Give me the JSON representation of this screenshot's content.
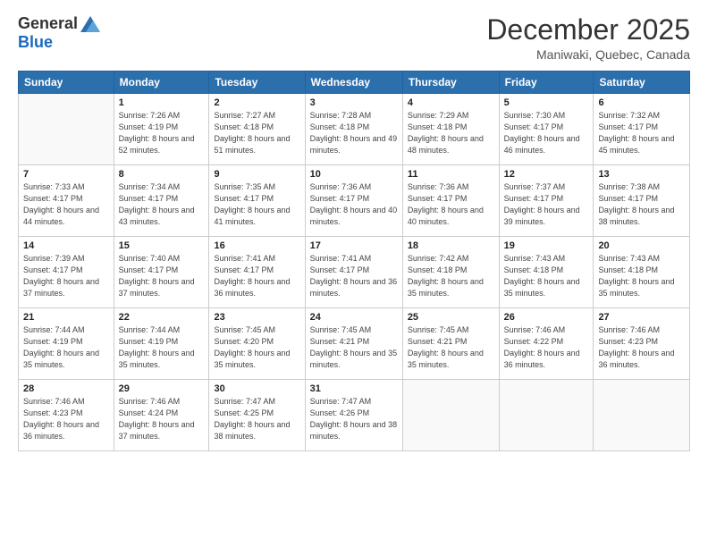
{
  "logo": {
    "general": "General",
    "blue": "Blue"
  },
  "title": "December 2025",
  "location": "Maniwaki, Quebec, Canada",
  "days_header": [
    "Sunday",
    "Monday",
    "Tuesday",
    "Wednesday",
    "Thursday",
    "Friday",
    "Saturday"
  ],
  "weeks": [
    [
      {
        "num": "",
        "sunrise": "",
        "sunset": "",
        "daylight": ""
      },
      {
        "num": "1",
        "sunrise": "Sunrise: 7:26 AM",
        "sunset": "Sunset: 4:19 PM",
        "daylight": "Daylight: 8 hours and 52 minutes."
      },
      {
        "num": "2",
        "sunrise": "Sunrise: 7:27 AM",
        "sunset": "Sunset: 4:18 PM",
        "daylight": "Daylight: 8 hours and 51 minutes."
      },
      {
        "num": "3",
        "sunrise": "Sunrise: 7:28 AM",
        "sunset": "Sunset: 4:18 PM",
        "daylight": "Daylight: 8 hours and 49 minutes."
      },
      {
        "num": "4",
        "sunrise": "Sunrise: 7:29 AM",
        "sunset": "Sunset: 4:18 PM",
        "daylight": "Daylight: 8 hours and 48 minutes."
      },
      {
        "num": "5",
        "sunrise": "Sunrise: 7:30 AM",
        "sunset": "Sunset: 4:17 PM",
        "daylight": "Daylight: 8 hours and 46 minutes."
      },
      {
        "num": "6",
        "sunrise": "Sunrise: 7:32 AM",
        "sunset": "Sunset: 4:17 PM",
        "daylight": "Daylight: 8 hours and 45 minutes."
      }
    ],
    [
      {
        "num": "7",
        "sunrise": "Sunrise: 7:33 AM",
        "sunset": "Sunset: 4:17 PM",
        "daylight": "Daylight: 8 hours and 44 minutes."
      },
      {
        "num": "8",
        "sunrise": "Sunrise: 7:34 AM",
        "sunset": "Sunset: 4:17 PM",
        "daylight": "Daylight: 8 hours and 43 minutes."
      },
      {
        "num": "9",
        "sunrise": "Sunrise: 7:35 AM",
        "sunset": "Sunset: 4:17 PM",
        "daylight": "Daylight: 8 hours and 41 minutes."
      },
      {
        "num": "10",
        "sunrise": "Sunrise: 7:36 AM",
        "sunset": "Sunset: 4:17 PM",
        "daylight": "Daylight: 8 hours and 40 minutes."
      },
      {
        "num": "11",
        "sunrise": "Sunrise: 7:36 AM",
        "sunset": "Sunset: 4:17 PM",
        "daylight": "Daylight: 8 hours and 40 minutes."
      },
      {
        "num": "12",
        "sunrise": "Sunrise: 7:37 AM",
        "sunset": "Sunset: 4:17 PM",
        "daylight": "Daylight: 8 hours and 39 minutes."
      },
      {
        "num": "13",
        "sunrise": "Sunrise: 7:38 AM",
        "sunset": "Sunset: 4:17 PM",
        "daylight": "Daylight: 8 hours and 38 minutes."
      }
    ],
    [
      {
        "num": "14",
        "sunrise": "Sunrise: 7:39 AM",
        "sunset": "Sunset: 4:17 PM",
        "daylight": "Daylight: 8 hours and 37 minutes."
      },
      {
        "num": "15",
        "sunrise": "Sunrise: 7:40 AM",
        "sunset": "Sunset: 4:17 PM",
        "daylight": "Daylight: 8 hours and 37 minutes."
      },
      {
        "num": "16",
        "sunrise": "Sunrise: 7:41 AM",
        "sunset": "Sunset: 4:17 PM",
        "daylight": "Daylight: 8 hours and 36 minutes."
      },
      {
        "num": "17",
        "sunrise": "Sunrise: 7:41 AM",
        "sunset": "Sunset: 4:17 PM",
        "daylight": "Daylight: 8 hours and 36 minutes."
      },
      {
        "num": "18",
        "sunrise": "Sunrise: 7:42 AM",
        "sunset": "Sunset: 4:18 PM",
        "daylight": "Daylight: 8 hours and 35 minutes."
      },
      {
        "num": "19",
        "sunrise": "Sunrise: 7:43 AM",
        "sunset": "Sunset: 4:18 PM",
        "daylight": "Daylight: 8 hours and 35 minutes."
      },
      {
        "num": "20",
        "sunrise": "Sunrise: 7:43 AM",
        "sunset": "Sunset: 4:18 PM",
        "daylight": "Daylight: 8 hours and 35 minutes."
      }
    ],
    [
      {
        "num": "21",
        "sunrise": "Sunrise: 7:44 AM",
        "sunset": "Sunset: 4:19 PM",
        "daylight": "Daylight: 8 hours and 35 minutes."
      },
      {
        "num": "22",
        "sunrise": "Sunrise: 7:44 AM",
        "sunset": "Sunset: 4:19 PM",
        "daylight": "Daylight: 8 hours and 35 minutes."
      },
      {
        "num": "23",
        "sunrise": "Sunrise: 7:45 AM",
        "sunset": "Sunset: 4:20 PM",
        "daylight": "Daylight: 8 hours and 35 minutes."
      },
      {
        "num": "24",
        "sunrise": "Sunrise: 7:45 AM",
        "sunset": "Sunset: 4:21 PM",
        "daylight": "Daylight: 8 hours and 35 minutes."
      },
      {
        "num": "25",
        "sunrise": "Sunrise: 7:45 AM",
        "sunset": "Sunset: 4:21 PM",
        "daylight": "Daylight: 8 hours and 35 minutes."
      },
      {
        "num": "26",
        "sunrise": "Sunrise: 7:46 AM",
        "sunset": "Sunset: 4:22 PM",
        "daylight": "Daylight: 8 hours and 36 minutes."
      },
      {
        "num": "27",
        "sunrise": "Sunrise: 7:46 AM",
        "sunset": "Sunset: 4:23 PM",
        "daylight": "Daylight: 8 hours and 36 minutes."
      }
    ],
    [
      {
        "num": "28",
        "sunrise": "Sunrise: 7:46 AM",
        "sunset": "Sunset: 4:23 PM",
        "daylight": "Daylight: 8 hours and 36 minutes."
      },
      {
        "num": "29",
        "sunrise": "Sunrise: 7:46 AM",
        "sunset": "Sunset: 4:24 PM",
        "daylight": "Daylight: 8 hours and 37 minutes."
      },
      {
        "num": "30",
        "sunrise": "Sunrise: 7:47 AM",
        "sunset": "Sunset: 4:25 PM",
        "daylight": "Daylight: 8 hours and 38 minutes."
      },
      {
        "num": "31",
        "sunrise": "Sunrise: 7:47 AM",
        "sunset": "Sunset: 4:26 PM",
        "daylight": "Daylight: 8 hours and 38 minutes."
      },
      {
        "num": "",
        "sunrise": "",
        "sunset": "",
        "daylight": ""
      },
      {
        "num": "",
        "sunrise": "",
        "sunset": "",
        "daylight": ""
      },
      {
        "num": "",
        "sunrise": "",
        "sunset": "",
        "daylight": ""
      }
    ]
  ]
}
